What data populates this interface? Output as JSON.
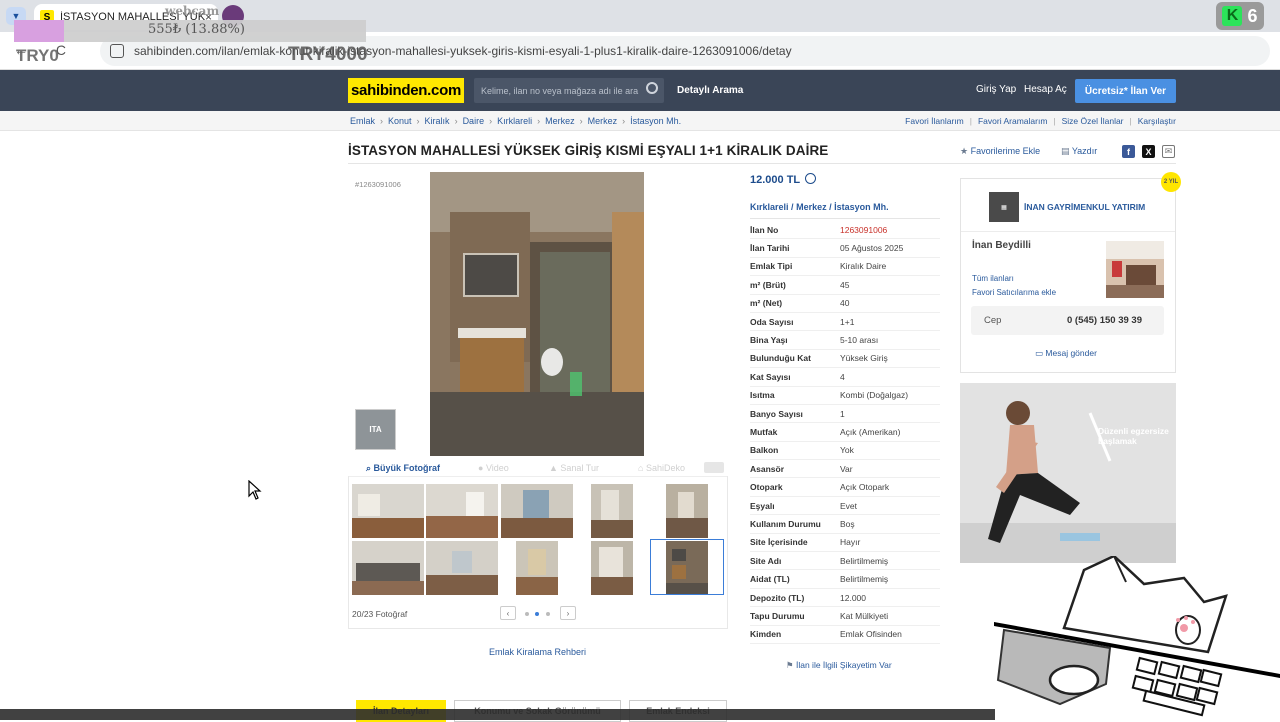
{
  "browser": {
    "tab_title": "İSTASYON MAHALLESİ YÜKSEK",
    "tab_close": "×",
    "nav_buttons": "← C",
    "url": "sahibinden.com/ilan/emlak-konut-kiralik-istasyon-mahallesi-yuksek-giris-kismi-esyali-1-plus1-kiralik-daire-1263091006/detay"
  },
  "overlay": {
    "webcam": "webcam",
    "percent": "555₺ (13.88%)",
    "try_left": "TRY0",
    "try_right": "TRY4000",
    "badge_count": "6"
  },
  "header": {
    "logo": "sahibinden.com",
    "search_placeholder": "Kelime, ilan no veya mağaza adı ile ara",
    "detailed_search": "Detaylı Arama",
    "login": "Giriş Yap",
    "register": "Hesap Aç",
    "post_ad": "Ücretsiz* İlan Ver"
  },
  "breadcrumb": [
    "Emlak",
    "Konut",
    "Kiralık",
    "Daire",
    "Kırklareli",
    "Merkez",
    "Merkez",
    "İstasyon Mh."
  ],
  "top_links": [
    "Favori İlanlarım",
    "Favori Aramalarım",
    "Size Özel İlanlar",
    "Karşılaştır"
  ],
  "listing": {
    "title": "İSTASYON MAHALLESİ YÜKSEK GİRİŞ KISMİ EŞYALI 1+1 KİRALIK DAİRE",
    "favorite_add": "Favorilerime Ekle",
    "print": "Yazdır",
    "listing_id": "#1263091006",
    "price": "12.000 TL",
    "location": [
      "Kırklareli",
      "Merkez",
      "İstasyon Mh."
    ],
    "location_sep": "/",
    "complaint": "İlan ile İlgili Şikayetim Var"
  },
  "gallery": {
    "big_photo": "Büyük Fotoğraf",
    "video": "Video",
    "virtual_tour": "Sanal Tur",
    "sahidecor": "SahiDeko",
    "photo_count": "20/23 Fotoğraf",
    "prev": "‹",
    "next": "›",
    "rent_guide": "Emlak Kiralama Rehberi",
    "watermark": "ITA"
  },
  "info": [
    {
      "k": "İlan No",
      "v": "1263091006",
      "red": true
    },
    {
      "k": "İlan Tarihi",
      "v": "05 Ağustos 2025"
    },
    {
      "k": "Emlak Tipi",
      "v": "Kiralık Daire"
    },
    {
      "k": "m² (Brüt)",
      "v": "45"
    },
    {
      "k": "m² (Net)",
      "v": "40"
    },
    {
      "k": "Oda Sayısı",
      "v": "1+1"
    },
    {
      "k": "Bina Yaşı",
      "v": "5-10 arası"
    },
    {
      "k": "Bulunduğu Kat",
      "v": "Yüksek Giriş"
    },
    {
      "k": "Kat Sayısı",
      "v": "4"
    },
    {
      "k": "Isıtma",
      "v": "Kombi (Doğalgaz)"
    },
    {
      "k": "Banyo Sayısı",
      "v": "1"
    },
    {
      "k": "Mutfak",
      "v": "Açık (Amerikan)"
    },
    {
      "k": "Balkon",
      "v": "Yok"
    },
    {
      "k": "Asansör",
      "v": "Var"
    },
    {
      "k": "Otopark",
      "v": "Açık Otopark"
    },
    {
      "k": "Eşyalı",
      "v": "Evet"
    },
    {
      "k": "Kullanım Durumu",
      "v": "Boş"
    },
    {
      "k": "Site İçerisinde",
      "v": "Hayır"
    },
    {
      "k": "Site Adı",
      "v": "Belirtilmemiş"
    },
    {
      "k": "Aidat (TL)",
      "v": "Belirtilmemiş"
    },
    {
      "k": "Depozito (TL)",
      "v": "12.000"
    },
    {
      "k": "Tapu Durumu",
      "v": "Kat Mülkiyeti"
    },
    {
      "k": "Kimden",
      "v": "Emlak Ofisinden"
    }
  ],
  "seller": {
    "badge": "2 YIL",
    "firm": "İNAN GAYRİMENKUL YATIRIM",
    "agent": "İnan Beydilli",
    "all_listings": "Tüm ilanları",
    "fav_sellers": "Favori Satıcılarıma ekle",
    "phone_label": "Cep",
    "phone": "0 (545) 150 39 39",
    "message": "Mesaj gönder"
  },
  "ad": {
    "text": "Düzenli egzersize başlamak"
  },
  "bottom_tabs": [
    "İlan Detayları",
    "Konumu ve Sokak Görünümü",
    "Emlak Endeksi"
  ],
  "colors": {
    "brand_yellow": "#ffe800",
    "header_bg": "#3a4557",
    "link_blue": "#2a5a9c",
    "cta_blue": "#4a90e2"
  }
}
